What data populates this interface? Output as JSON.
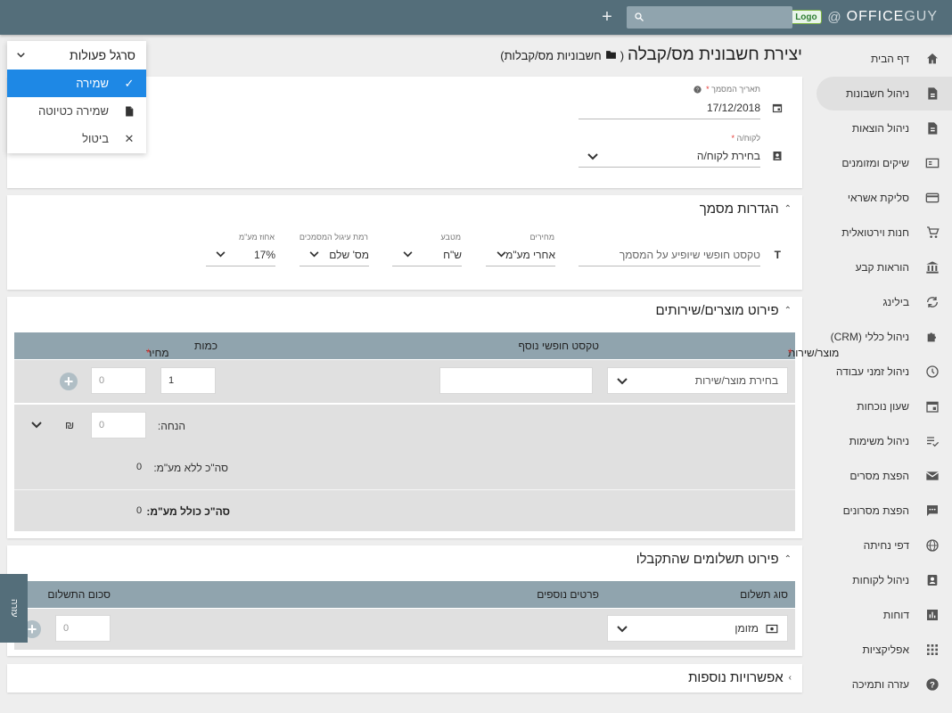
{
  "topbar": {
    "brand": "OFFICE",
    "brand2": "GUY",
    "at": "@",
    "logo": "Logo",
    "plus": "+"
  },
  "sidebar": {
    "items": [
      {
        "label": "דף הבית",
        "icon": "home-icon"
      },
      {
        "label": "ניהול חשבונות",
        "icon": "invoice-icon",
        "active": true
      },
      {
        "label": "ניהול הוצאות",
        "icon": "receipt-icon"
      },
      {
        "label": "שיקים ומזומנים",
        "icon": "cash-icon"
      },
      {
        "label": "סליקת אשראי",
        "icon": "credit-card-icon"
      },
      {
        "label": "חנות וירטואלית",
        "icon": "cart-icon"
      },
      {
        "label": "הוראות קבע",
        "icon": "bank-icon"
      },
      {
        "label": "בילינג",
        "icon": "sync-icon"
      },
      {
        "label": "ניהול כללי (CRM)",
        "icon": "puzzle-icon"
      },
      {
        "label": "ניהול זמני עבודה",
        "icon": "clock-icon"
      },
      {
        "label": "שעון נוכחות",
        "icon": "calendar-icon"
      },
      {
        "label": "ניהול משימות",
        "icon": "checklist-icon"
      },
      {
        "label": "הפצת מסרים",
        "icon": "mail-icon"
      },
      {
        "label": "הפצת מסרונים",
        "icon": "sms-icon"
      },
      {
        "label": "דפי נחיתה",
        "icon": "globe-icon"
      },
      {
        "label": "ניהול לקוחות",
        "icon": "contacts-icon"
      },
      {
        "label": "דוחות",
        "icon": "chart-icon"
      },
      {
        "label": "אפליקציות",
        "icon": "apps-icon"
      },
      {
        "label": "עזרה ותמיכה",
        "icon": "help-icon"
      }
    ]
  },
  "page": {
    "title": "יצירת חשבונית מס/קבלה",
    "breadcrumb_open": "(",
    "breadcrumb": "חשבוניות מס/קבלות)"
  },
  "actions": {
    "title": "סרגל פעולות",
    "items": [
      {
        "label": "שמירה",
        "icon": "check-icon"
      },
      {
        "label": "שמירה כטיוטה",
        "icon": "draft-icon"
      },
      {
        "label": "ביטול",
        "icon": "close-icon"
      }
    ]
  },
  "doc": {
    "date_label": "תאריך המסמך",
    "date_value": "17/12/2018",
    "customer_label": "לקוח/ה",
    "customer_placeholder": "בחירת לקוח/ה",
    "req": "*"
  },
  "settings": {
    "title": "הגדרות מסמך",
    "freetext_placeholder": "טקסט חופשי שיופיע על המסמך",
    "prices_label": "מחירים",
    "prices_value": "אחרי מע\"מ",
    "currency_label": "מטבע",
    "currency_value": "ש\"ח",
    "rounding_label": "רמת עיגול המסמכים",
    "rounding_value": "מס' שלם",
    "vat_label": "אחוז מע\"מ",
    "vat_value": "17%"
  },
  "products": {
    "title": "פירוט מוצרים/שירותים",
    "col_product": "מוצר/שירות",
    "col_text": "טקסט חופשי נוסף",
    "col_qty": "כמות",
    "col_price": "מחיר",
    "product_placeholder": "בחירת מוצר/שירות",
    "qty": "1",
    "price": "0",
    "discount_label": "הנחה:",
    "discount_value": "0",
    "currency_symbol": "₪",
    "total_novat_label": "סה\"כ ללא מע\"מ:",
    "total_novat": "0",
    "total_vat_label": "סה\"כ כולל מע\"מ:",
    "total_vat": "0"
  },
  "payments": {
    "title": "פירוט תשלומים שהתקבלו",
    "col_type": "סוג תשלום",
    "col_details": "פרטים נוספים",
    "col_sum": "סכום התשלום",
    "type_value": "מזומן",
    "sum": "0"
  },
  "more": {
    "title": "אפשרויות נוספות"
  },
  "sidetab": {
    "label": "עזרה"
  }
}
